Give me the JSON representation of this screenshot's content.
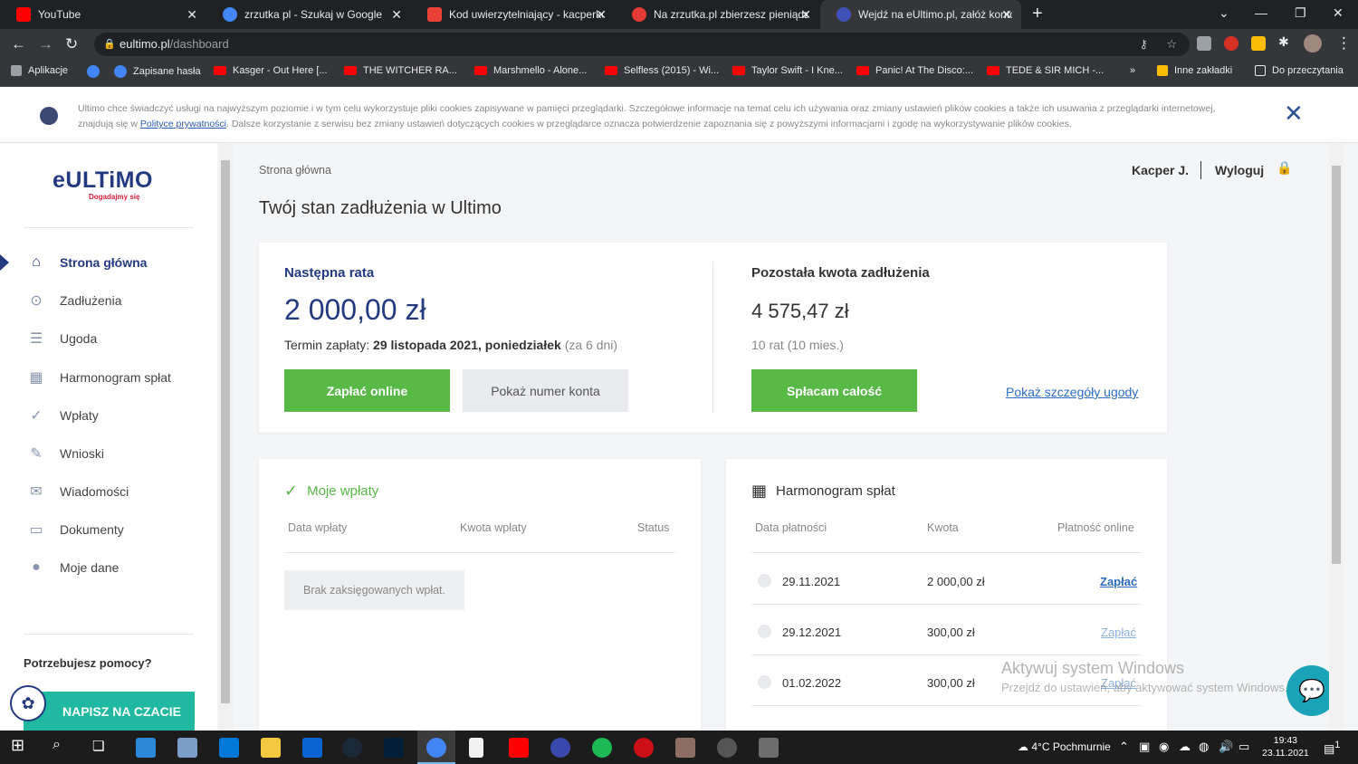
{
  "browser": {
    "tabs": [
      {
        "title": "YouTube",
        "color": "#ff0000"
      },
      {
        "title": "zrzutka pl - Szukaj w Google",
        "color": "#4285f4"
      },
      {
        "title": "Kod uwierzytelniający - kacperko",
        "color": "#ea4335"
      },
      {
        "title": "Na zrzutka.pl zbierzesz pieniądze",
        "color": "#e53935"
      },
      {
        "title": "Wejdź na eUltimo.pl, załóż konto",
        "color": "#3f51b5"
      }
    ],
    "url_host": "eultimo.pl",
    "url_path": "/dashboard",
    "bookmarks": [
      "Aplikacje",
      "Zapisane hasła",
      "Kasger - Out Here [...",
      "THE WITCHER RA...",
      "Marshmello - Alone...",
      "Selfless (2015) - Wi...",
      "Taylor Swift - I Kne...",
      "Panic! At The Disco:...",
      "TEDE & SIR MICH -..."
    ],
    "bookmarks_more": "»",
    "other_bookmarks": "Inne zakładki",
    "reading_list": "Do przeczytania"
  },
  "cookie_banner": {
    "text_before": "Ultimo chce świadczyć usługi na najwyższym poziomie i w tym celu wykorzystuje pliki cookies zapisywane w pamięci przeglądarki. Szczegółowe informacje na temat celu ich używania oraz zmiany ustawień plików cookies a także ich usuwania z przeglądarki internetowej, znajdują się w ",
    "link": "Polityce prywatności",
    "text_after": ". Dalsze korzystanie z serwisu bez zmiany ustawień dotyczących cookies w przeglądarce oznacza potwierdzenie zapoznania się z powyższymi informacjami i zgodę na wykorzystywanie plików cookies.",
    "close": "✕"
  },
  "sidebar": {
    "logo": "eULTiMO",
    "tagline": "Dogadajmy się",
    "items": [
      {
        "label": "Strona główna",
        "icon": "⌂"
      },
      {
        "label": "Zadłużenia",
        "icon": "⊙"
      },
      {
        "label": "Ugoda",
        "icon": "☰"
      },
      {
        "label": "Harmonogram spłat",
        "icon": "▦"
      },
      {
        "label": "Wpłaty",
        "icon": "✓"
      },
      {
        "label": "Wnioski",
        "icon": "✎"
      },
      {
        "label": "Wiadomości",
        "icon": "✉"
      },
      {
        "label": "Dokumenty",
        "icon": "▭"
      },
      {
        "label": "Moje dane",
        "icon": "●"
      }
    ],
    "help": "Potrzebujesz pomocy?",
    "chat_button": "NAPISZ NA CZACIE"
  },
  "header": {
    "breadcrumb": "Strona główna",
    "user": "Kacper J.",
    "logout": "Wyloguj",
    "title": "Twój stan zadłużenia w Ultimo"
  },
  "summary": {
    "next_label": "Następna rata",
    "next_amount": "2 000,00 zł",
    "term_prefix": "Termin zapłaty: ",
    "term_date": "29 listopada 2021, poniedziałek",
    "term_days": " (za 6 dni)",
    "pay_online": "Zapłać online",
    "show_account": "Pokaż numer konta",
    "remaining_label": "Pozostała kwota zadłużenia",
    "remaining_amount": "4 575,47 zł",
    "installments": "10 rat (10 mies.)",
    "pay_all": "Spłacam całość",
    "details_link": "Pokaż szczegóły ugody"
  },
  "payments": {
    "title": "Moje wpłaty",
    "headers": [
      "Data wpłaty",
      "Kwota wpłaty",
      "Status"
    ],
    "empty": "Brak zaksięgowanych wpłat."
  },
  "schedule": {
    "title": "Harmonogram spłat",
    "headers": [
      "Data płatności",
      "Kwota",
      "Płatność online"
    ],
    "rows": [
      {
        "date": "29.11.2021",
        "amount": "2 000,00 zł",
        "action": "Zapłać"
      },
      {
        "date": "29.12.2021",
        "amount": "300,00 zł",
        "action": "Zapłać"
      },
      {
        "date": "01.02.2022",
        "amount": "300,00 zł",
        "action": "Zapłać"
      }
    ]
  },
  "watermark": {
    "line1": "Aktywuj system Windows",
    "line2": "Przejdź do ustawień, aby aktywować system Windows."
  },
  "taskbar": {
    "weather": "4°C  Pochmurnie",
    "time": "19:43",
    "date": "23.11.2021",
    "notifications": "1"
  },
  "colors": {
    "brand": "#243a80",
    "accent_green": "#58b947",
    "link": "#2d6cc0",
    "chat": "#20b8a0"
  }
}
